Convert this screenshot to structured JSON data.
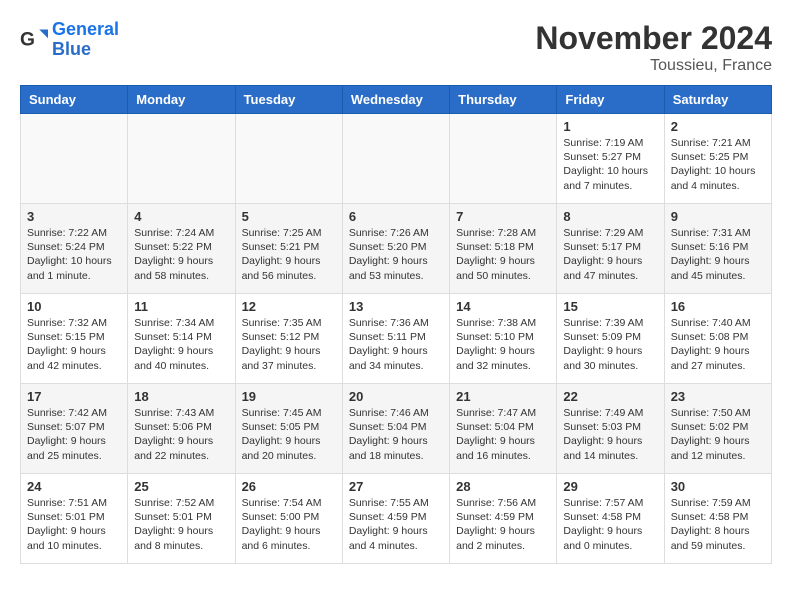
{
  "header": {
    "logo_line1": "General",
    "logo_line2": "Blue",
    "month": "November 2024",
    "location": "Toussieu, France"
  },
  "weekdays": [
    "Sunday",
    "Monday",
    "Tuesday",
    "Wednesday",
    "Thursday",
    "Friday",
    "Saturday"
  ],
  "weeks": [
    [
      {
        "day": "",
        "info": ""
      },
      {
        "day": "",
        "info": ""
      },
      {
        "day": "",
        "info": ""
      },
      {
        "day": "",
        "info": ""
      },
      {
        "day": "",
        "info": ""
      },
      {
        "day": "1",
        "info": "Sunrise: 7:19 AM\nSunset: 5:27 PM\nDaylight: 10 hours and 7 minutes."
      },
      {
        "day": "2",
        "info": "Sunrise: 7:21 AM\nSunset: 5:25 PM\nDaylight: 10 hours and 4 minutes."
      }
    ],
    [
      {
        "day": "3",
        "info": "Sunrise: 7:22 AM\nSunset: 5:24 PM\nDaylight: 10 hours and 1 minute."
      },
      {
        "day": "4",
        "info": "Sunrise: 7:24 AM\nSunset: 5:22 PM\nDaylight: 9 hours and 58 minutes."
      },
      {
        "day": "5",
        "info": "Sunrise: 7:25 AM\nSunset: 5:21 PM\nDaylight: 9 hours and 56 minutes."
      },
      {
        "day": "6",
        "info": "Sunrise: 7:26 AM\nSunset: 5:20 PM\nDaylight: 9 hours and 53 minutes."
      },
      {
        "day": "7",
        "info": "Sunrise: 7:28 AM\nSunset: 5:18 PM\nDaylight: 9 hours and 50 minutes."
      },
      {
        "day": "8",
        "info": "Sunrise: 7:29 AM\nSunset: 5:17 PM\nDaylight: 9 hours and 47 minutes."
      },
      {
        "day": "9",
        "info": "Sunrise: 7:31 AM\nSunset: 5:16 PM\nDaylight: 9 hours and 45 minutes."
      }
    ],
    [
      {
        "day": "10",
        "info": "Sunrise: 7:32 AM\nSunset: 5:15 PM\nDaylight: 9 hours and 42 minutes."
      },
      {
        "day": "11",
        "info": "Sunrise: 7:34 AM\nSunset: 5:14 PM\nDaylight: 9 hours and 40 minutes."
      },
      {
        "day": "12",
        "info": "Sunrise: 7:35 AM\nSunset: 5:12 PM\nDaylight: 9 hours and 37 minutes."
      },
      {
        "day": "13",
        "info": "Sunrise: 7:36 AM\nSunset: 5:11 PM\nDaylight: 9 hours and 34 minutes."
      },
      {
        "day": "14",
        "info": "Sunrise: 7:38 AM\nSunset: 5:10 PM\nDaylight: 9 hours and 32 minutes."
      },
      {
        "day": "15",
        "info": "Sunrise: 7:39 AM\nSunset: 5:09 PM\nDaylight: 9 hours and 30 minutes."
      },
      {
        "day": "16",
        "info": "Sunrise: 7:40 AM\nSunset: 5:08 PM\nDaylight: 9 hours and 27 minutes."
      }
    ],
    [
      {
        "day": "17",
        "info": "Sunrise: 7:42 AM\nSunset: 5:07 PM\nDaylight: 9 hours and 25 minutes."
      },
      {
        "day": "18",
        "info": "Sunrise: 7:43 AM\nSunset: 5:06 PM\nDaylight: 9 hours and 22 minutes."
      },
      {
        "day": "19",
        "info": "Sunrise: 7:45 AM\nSunset: 5:05 PM\nDaylight: 9 hours and 20 minutes."
      },
      {
        "day": "20",
        "info": "Sunrise: 7:46 AM\nSunset: 5:04 PM\nDaylight: 9 hours and 18 minutes."
      },
      {
        "day": "21",
        "info": "Sunrise: 7:47 AM\nSunset: 5:04 PM\nDaylight: 9 hours and 16 minutes."
      },
      {
        "day": "22",
        "info": "Sunrise: 7:49 AM\nSunset: 5:03 PM\nDaylight: 9 hours and 14 minutes."
      },
      {
        "day": "23",
        "info": "Sunrise: 7:50 AM\nSunset: 5:02 PM\nDaylight: 9 hours and 12 minutes."
      }
    ],
    [
      {
        "day": "24",
        "info": "Sunrise: 7:51 AM\nSunset: 5:01 PM\nDaylight: 9 hours and 10 minutes."
      },
      {
        "day": "25",
        "info": "Sunrise: 7:52 AM\nSunset: 5:01 PM\nDaylight: 9 hours and 8 minutes."
      },
      {
        "day": "26",
        "info": "Sunrise: 7:54 AM\nSunset: 5:00 PM\nDaylight: 9 hours and 6 minutes."
      },
      {
        "day": "27",
        "info": "Sunrise: 7:55 AM\nSunset: 4:59 PM\nDaylight: 9 hours and 4 minutes."
      },
      {
        "day": "28",
        "info": "Sunrise: 7:56 AM\nSunset: 4:59 PM\nDaylight: 9 hours and 2 minutes."
      },
      {
        "day": "29",
        "info": "Sunrise: 7:57 AM\nSunset: 4:58 PM\nDaylight: 9 hours and 0 minutes."
      },
      {
        "day": "30",
        "info": "Sunrise: 7:59 AM\nSunset: 4:58 PM\nDaylight: 8 hours and 59 minutes."
      }
    ]
  ]
}
